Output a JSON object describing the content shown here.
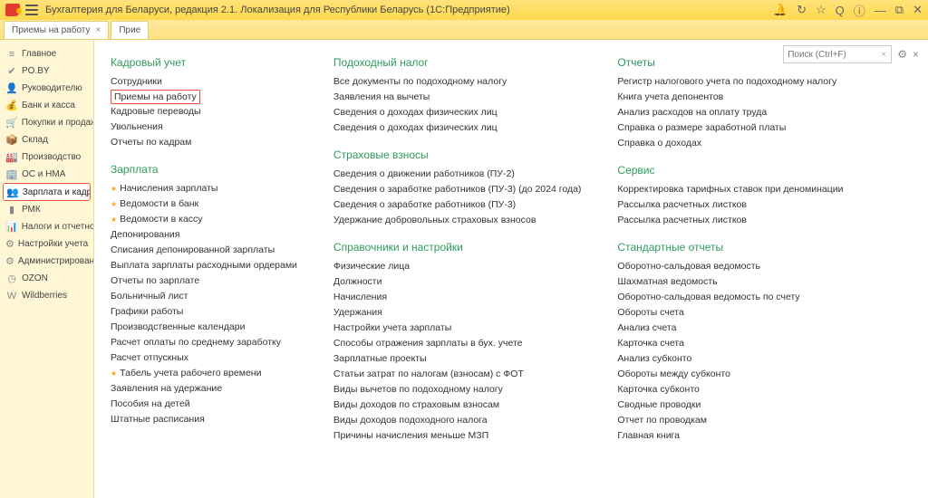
{
  "title": "Бухгалтерия для Беларуси, редакция 2.1. Локализация для Республики Беларусь  (1С:Предприятие)",
  "tabs": [
    {
      "label": "Приемы на работу",
      "closable": true
    },
    {
      "label": "Прие",
      "closable": false
    }
  ],
  "search": {
    "placeholder": "Поиск (Ctrl+F)"
  },
  "sidebar": [
    {
      "icon": "≡",
      "label": "Главное"
    },
    {
      "icon": "✔",
      "label": "PO.BY"
    },
    {
      "icon": "👤",
      "label": "Руководителю"
    },
    {
      "icon": "💰",
      "label": "Банк и касса"
    },
    {
      "icon": "🛒",
      "label": "Покупки и продажи"
    },
    {
      "icon": "📦",
      "label": "Склад"
    },
    {
      "icon": "🏭",
      "label": "Производство"
    },
    {
      "icon": "🏢",
      "label": "ОС и НМА"
    },
    {
      "icon": "👥",
      "label": "Зарплата и кадры"
    },
    {
      "icon": "▮",
      "label": "РМК"
    },
    {
      "icon": "📊",
      "label": "Налоги и отчетность"
    },
    {
      "icon": "⚙",
      "label": "Настройки учета"
    },
    {
      "icon": "⚙",
      "label": "Администрирование"
    },
    {
      "icon": "◷",
      "label": "OZON"
    },
    {
      "icon": "W",
      "label": "Wildberries"
    }
  ],
  "columns": [
    [
      {
        "title": "Кадровый учет",
        "items": [
          {
            "t": "Сотрудники"
          },
          {
            "t": "Приемы на работу",
            "hl": true
          },
          {
            "t": "Кадровые переводы"
          },
          {
            "t": "Увольнения"
          },
          {
            "t": "Отчеты по кадрам"
          }
        ]
      },
      {
        "title": "Зарплата",
        "items": [
          {
            "t": "Начисления зарплаты",
            "star": true
          },
          {
            "t": "Ведомости в банк",
            "star": true
          },
          {
            "t": "Ведомости в кассу",
            "star": true
          },
          {
            "t": "Депонирования"
          },
          {
            "t": "Списания депонированной зарплаты"
          },
          {
            "t": "Выплата зарплаты расходными ордерами"
          },
          {
            "t": "Отчеты по зарплате"
          },
          {
            "t": "Больничный лист"
          },
          {
            "t": "Графики работы"
          },
          {
            "t": "Производственные календари"
          },
          {
            "t": "Расчет оплаты по среднему заработку"
          },
          {
            "t": "Расчет отпускных"
          },
          {
            "t": "Табель учета рабочего времени",
            "star": true
          },
          {
            "t": "Заявления на удержание"
          },
          {
            "t": "Пособия на детей"
          },
          {
            "t": "Штатные расписания"
          }
        ]
      }
    ],
    [
      {
        "title": "Подоходный налог",
        "items": [
          {
            "t": "Все документы по подоходному налогу"
          },
          {
            "t": "Заявления на вычеты"
          },
          {
            "t": "Сведения о доходах физических лиц"
          },
          {
            "t": "Сведения о доходах физических лиц"
          }
        ]
      },
      {
        "title": "Страховые взносы",
        "items": [
          {
            "t": "Сведения о движении работников (ПУ-2)"
          },
          {
            "t": "Сведения о заработке работников (ПУ-3) (до 2024 года)"
          },
          {
            "t": "Сведения о заработке работников (ПУ-3)"
          },
          {
            "t": "Удержание добровольных страховых взносов"
          }
        ]
      },
      {
        "title": "Справочники и настройки",
        "items": [
          {
            "t": "Физические лица"
          },
          {
            "t": "Должности"
          },
          {
            "t": "Начисления"
          },
          {
            "t": "Удержания"
          },
          {
            "t": "Настройки учета зарплаты"
          },
          {
            "t": "Способы отражения зарплаты в бух. учете"
          },
          {
            "t": "Зарплатные проекты"
          },
          {
            "t": "Статьи затрат по налогам (взносам) с ФОТ"
          },
          {
            "t": "Виды вычетов по подоходному налогу"
          },
          {
            "t": "Виды доходов по страховым взносам"
          },
          {
            "t": "Виды доходов подоходного налога"
          },
          {
            "t": "Причины начисления меньше МЗП"
          }
        ]
      }
    ],
    [
      {
        "title": "Отчеты",
        "items": [
          {
            "t": "Регистр налогового учета по подоходному налогу"
          },
          {
            "t": "Книга учета депонентов"
          },
          {
            "t": "Анализ расходов на оплату труда"
          },
          {
            "t": "Справка о размере заработной платы"
          },
          {
            "t": "Справка о доходах"
          }
        ]
      },
      {
        "title": "Сервис",
        "items": [
          {
            "t": "Корректировка тарифных ставок при деноминации"
          },
          {
            "t": "Рассылка расчетных листков"
          },
          {
            "t": "Рассылка расчетных листков"
          }
        ]
      },
      {
        "title": "Стандартные отчеты",
        "items": [
          {
            "t": "Оборотно-сальдовая ведомость"
          },
          {
            "t": "Шахматная ведомость"
          },
          {
            "t": "Оборотно-сальдовая ведомость по счету"
          },
          {
            "t": "Обороты счета"
          },
          {
            "t": "Анализ счета"
          },
          {
            "t": "Карточка счета"
          },
          {
            "t": "Анализ субконто"
          },
          {
            "t": "Обороты между субконто"
          },
          {
            "t": "Карточка субконто"
          },
          {
            "t": "Сводные проводки"
          },
          {
            "t": "Отчет по проводкам"
          },
          {
            "t": "Главная книга"
          }
        ]
      }
    ]
  ]
}
